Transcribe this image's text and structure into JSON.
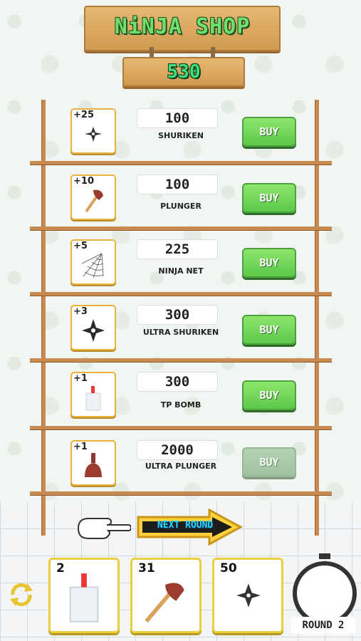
{
  "shop": {
    "title": "NiNJA SHOP",
    "coins": "530"
  },
  "items": [
    {
      "qty": "+25",
      "price": "100",
      "name": "SHURIKEN",
      "buy": "BUY",
      "enabled": true,
      "icon": "shuriken-icon"
    },
    {
      "qty": "+10",
      "price": "100",
      "name": "PLUNGER",
      "buy": "BUY",
      "enabled": true,
      "icon": "plunger-icon"
    },
    {
      "qty": "+5",
      "price": "225",
      "name": "NINJA NET",
      "buy": "BUY",
      "enabled": true,
      "icon": "ninja-net-icon"
    },
    {
      "qty": "+3",
      "price": "300",
      "name": "ULTRA SHURIKEN",
      "buy": "BUY",
      "enabled": true,
      "icon": "ultra-shuriken-icon"
    },
    {
      "qty": "+1",
      "price": "300",
      "name": "TP BOMB",
      "buy": "BUY",
      "enabled": true,
      "icon": "tp-bomb-icon"
    },
    {
      "qty": "+1",
      "price": "2000",
      "name": "ULTRA PLUNGER",
      "buy": "BUY",
      "enabled": false,
      "icon": "ultra-plunger-icon"
    }
  ],
  "next_round": {
    "label": "NEXT ROUND"
  },
  "inventory": [
    {
      "count": "2",
      "icon": "tp-bomb-icon"
    },
    {
      "count": "31",
      "icon": "plunger-icon"
    },
    {
      "count": "50",
      "icon": "shuriken-icon"
    }
  ],
  "round": {
    "label": "ROUND 2"
  },
  "colors": {
    "buy": "#5cc84a",
    "title": "#6fe16a",
    "coins": "#3fe07a",
    "next": "#2fd1ff",
    "frame": "#e9b23a"
  }
}
